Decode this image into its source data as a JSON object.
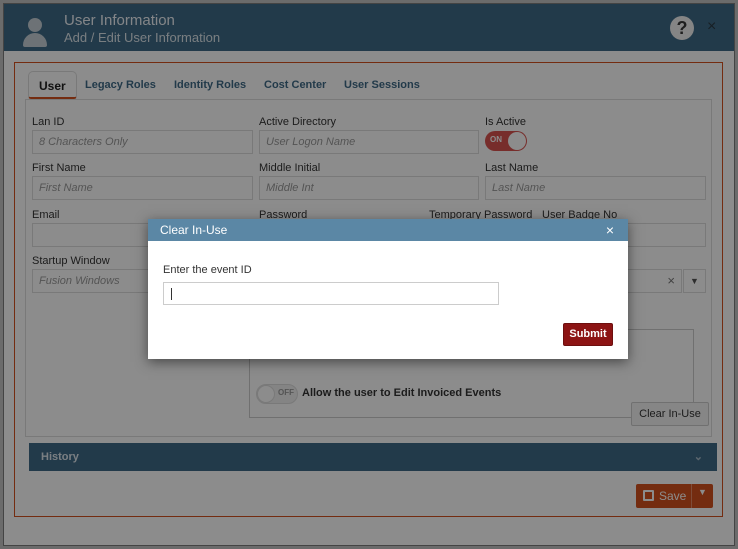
{
  "window": {
    "title": "User Information",
    "subtitle": "Add / Edit User Information",
    "help_label": "?",
    "close_label": "×"
  },
  "tabs": [
    {
      "label": "User",
      "active": true
    },
    {
      "label": "Legacy Roles"
    },
    {
      "label": "Identity Roles"
    },
    {
      "label": "Cost Center"
    },
    {
      "label": "User Sessions"
    }
  ],
  "form": {
    "lan_id": {
      "label": "Lan ID",
      "placeholder": "8 Characters Only"
    },
    "active_directory": {
      "label": "Active Directory",
      "placeholder": "User Logon Name"
    },
    "is_active": {
      "label": "Is Active",
      "toggle": "ON"
    },
    "first_name": {
      "label": "First Name",
      "placeholder": "First Name"
    },
    "middle_initial": {
      "label": "Middle Initial",
      "placeholder": "Middle Int"
    },
    "last_name": {
      "label": "Last Name",
      "placeholder": "Last Name"
    },
    "email": {
      "label": "Email"
    },
    "password": {
      "label": "Password"
    },
    "temporary_password": {
      "label": "Temporary Password"
    },
    "user_badge_no": {
      "label": "User Badge No"
    },
    "startup_window": {
      "label": "Startup Window",
      "value": "Fusion Windows"
    },
    "dropdown_clear": "×",
    "dropdown_arrow": "▼",
    "edit_invoiced": {
      "toggle": "OFF",
      "label": "Allow the user to Edit Invoiced Events"
    }
  },
  "clear_in_use_button": "Clear In-Use",
  "history": {
    "label": "History",
    "chevron": "⌄"
  },
  "save": {
    "label": "Save",
    "caret": "▼"
  },
  "dialog": {
    "title": "Clear In-Use",
    "close": "×",
    "label": "Enter the event ID",
    "value": "",
    "submit": "Submit"
  },
  "colors": {
    "header": "#3f6a87",
    "accent": "#d4511e",
    "dialog_header": "#5b87a5",
    "submit": "#8c1414"
  }
}
